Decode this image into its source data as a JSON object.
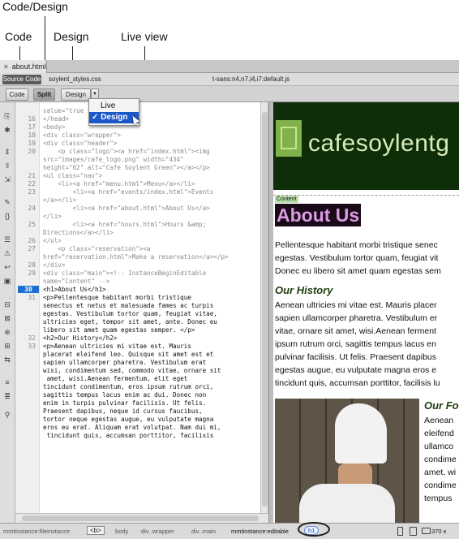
{
  "callouts": {
    "code_design": "Code/Design",
    "code": "Code",
    "design": "Design",
    "live_view": "Live view"
  },
  "document": {
    "tab_title": "about.html",
    "source_code_label": "Source Code",
    "related_files": "soylent_styles.css",
    "font_file": "t-sans:n4,n7,i4,i7:default.js"
  },
  "toolbar": {
    "code_label": "Code",
    "split_label": "Split",
    "design_label": "Design",
    "dropdown_glyph": "▼"
  },
  "view_menu": {
    "items": [
      {
        "label": "Live",
        "checked": false
      },
      {
        "label": "✓ Design",
        "checked": true
      }
    ]
  },
  "code_view": {
    "lines": [
      {
        "n": "",
        "text": "value=\"true"
      },
      {
        "n": "16",
        "text": "</head>"
      },
      {
        "n": "17",
        "text": "<body>"
      },
      {
        "n": "18",
        "text": "<div class=\"wrapper\">"
      },
      {
        "n": "19",
        "text": "<div class=\"header\">"
      },
      {
        "n": "20",
        "text": "    <p class=\"logo\"><a href=\"index.html\"><img"
      },
      {
        "n": "",
        "text": "src=\"images/cafe_logo.png\" width=\"434\""
      },
      {
        "n": "",
        "text": "height=\"62\" alt=\"Cafe Soylent Green\"></a></p>"
      },
      {
        "n": "21",
        "text": "<ul class=\"nav\">"
      },
      {
        "n": "22",
        "text": "    <li><a href=\"menu.html\">Menu</a></li>"
      },
      {
        "n": "23",
        "text": "        <li><a href=\"events/index.html\">Events"
      },
      {
        "n": "",
        "text": "</a></li>"
      },
      {
        "n": "24",
        "text": "        <li><a href=\"about.html\">About Us</a>"
      },
      {
        "n": "",
        "text": "</li>"
      },
      {
        "n": "25",
        "text": "        <li><a href=\"hours.html\">Hours &amp;"
      },
      {
        "n": "",
        "text": "Directions</a></li>"
      },
      {
        "n": "26",
        "text": "</ul>"
      },
      {
        "n": "27",
        "text": "    <p class=\"reservation\"><a"
      },
      {
        "n": "",
        "text": "href=\"reservation.html\">Make a reservation</a></p>"
      },
      {
        "n": "28",
        "text": "</div>"
      },
      {
        "n": "29",
        "text": "<div class=\"main\"><!-- InstanceBeginEditable"
      },
      {
        "n": "",
        "text": "name=\"Content\" -->"
      },
      {
        "n": "30",
        "text": "<h1>About Us</h1>"
      },
      {
        "n": "31",
        "text": "<p>Pellentesque habitant morbi tristique"
      },
      {
        "n": "",
        "text": "senectus et netus et malesuada fames ac turpis"
      },
      {
        "n": "",
        "text": "egestas. Vestibulum tortor quam, feugiat vitae,"
      },
      {
        "n": "",
        "text": "ultricies eget, tempor sit amet, ante. Donec eu"
      },
      {
        "n": "",
        "text": "libero sit amet quam egestas semper. </p>"
      },
      {
        "n": "32",
        "text": "<h2>Our History</h2>"
      },
      {
        "n": "33",
        "text": "<p>Aenean ultricies mi vitae est. Mauris"
      },
      {
        "n": "",
        "text": "placerat eleifend leo. Quisque sit amet est et"
      },
      {
        "n": "",
        "text": "sapien ullamcorper pharetra. Vestibulum erat"
      },
      {
        "n": "",
        "text": "wisi, condimentum sed, commodo vitae, ornare sit"
      },
      {
        "n": "",
        "text": " amet, wisi.Aenean fermentum, elit eget"
      },
      {
        "n": "",
        "text": "tincidunt condimentum, eros ipsum rutrum orci,"
      },
      {
        "n": "",
        "text": "sagittis tempus lacus enim ac dui. Donec non"
      },
      {
        "n": "",
        "text": "enim in turpis pulvinar facilisis. Ut felis."
      },
      {
        "n": "",
        "text": "Praesent dapibus, neque id cursus faucibus,"
      },
      {
        "n": "",
        "text": "tortor neque egestas augue, eu vulputate magna"
      },
      {
        "n": "",
        "text": "eros eu erat. Aliquam erat volutpat. Nam dui mi,"
      },
      {
        "n": "",
        "text": " tincidunt quis, accumsan porttitor, facilisis"
      }
    ]
  },
  "design_view": {
    "logo_text": "cafesoylentg",
    "content_tag": "Content",
    "heading": "About Us",
    "intro": [
      "Pellentesque habitant morbi tristique senec",
      "egestas. Vestibulum tortor quam, feugiat vit",
      "Donec eu libero sit amet quam egestas sem"
    ],
    "history_heading": "Our History",
    "history": [
      "Aenean ultricies mi vitae est. Mauris placer",
      "sapien ullamcorper pharetra. Vestibulum er",
      "vitae, ornare sit amet, wisi.Aenean ferment",
      "ipsum rutrum orci, sagittis tempus lacus en",
      "pulvinar facilisis. Ut felis. Praesent dapibus",
      "egestas augue, eu vulputate magna eros e",
      "tincidunt quis, accumsan porttitor, facilisis lu"
    ],
    "side_heading": "Our Fo",
    "side_text": [
      "Aenean",
      "eleifend",
      "ullamco",
      "condime",
      "amet, wi",
      "condime",
      "tempus"
    ]
  },
  "status_bar": {
    "crumbs": [
      "mmtinstance:fileinstance",
      "<b>",
      "body",
      "div .wrapper",
      "div .main",
      "mmtinstance:editable",
      "h1"
    ],
    "dimensions": "370 x"
  },
  "colors": {
    "header_bg": "#0d2e08",
    "heading_bg": "#1a0a18",
    "heading_fg": "#d99be2",
    "selection_blue": "#1b57c6"
  }
}
